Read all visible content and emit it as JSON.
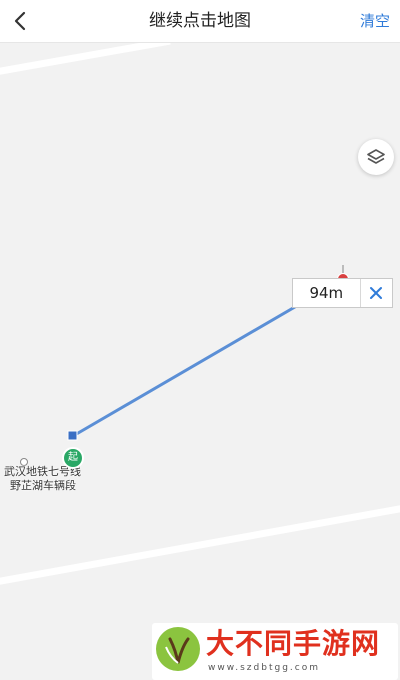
{
  "header": {
    "back_icon": "chevron-left-icon",
    "title": "继续点击地图",
    "clear_label": "清空"
  },
  "map": {
    "layer_icon": "layers-icon",
    "distance": {
      "value": "94m",
      "close_icon": "close-icon"
    },
    "start_marker": {
      "label": "起"
    },
    "poi": {
      "line1": "武汉地铁七号线",
      "line2": "野芷湖车辆段"
    },
    "colors": {
      "route": "#5b8fd6",
      "end_pin": "#d94040",
      "start_marker": "#2aa866",
      "road": "#ffffff",
      "map_bg": "#f2f2f2"
    }
  },
  "watermark": {
    "text": "大不同手游网",
    "url": "www.szdbtgg.com",
    "colors": {
      "text": "#e0301e",
      "logo": "#8bc43f"
    }
  }
}
